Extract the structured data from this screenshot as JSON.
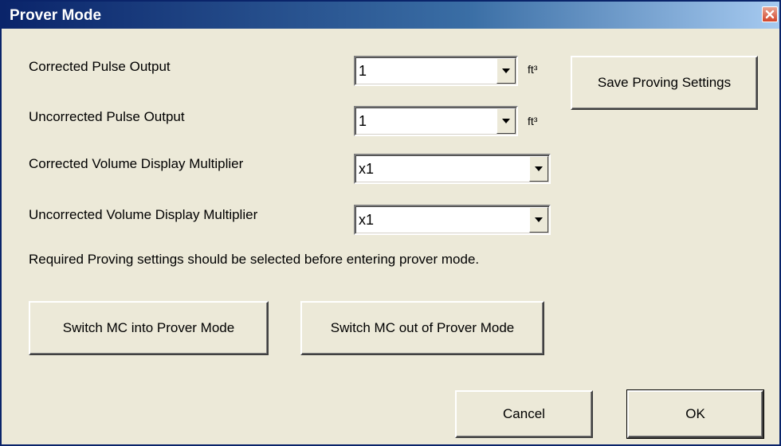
{
  "window": {
    "title": "Prover Mode",
    "close_icon": "close-icon"
  },
  "fields": [
    {
      "label": "Corrected Pulse Output",
      "value": "1",
      "unit": "ft³"
    },
    {
      "label": "Uncorrected Pulse Output",
      "value": "1",
      "unit": "ft³"
    },
    {
      "label": "Corrected Volume Display Multiplier",
      "value": "x1"
    },
    {
      "label": "Uncorrected Volume Display Multiplier",
      "value": "x1"
    }
  ],
  "note": "Required Proving settings should be selected before entering prover mode.",
  "buttons": {
    "save_proving": "Save Proving Settings",
    "switch_into": "Switch MC into Prover Mode",
    "switch_out": "Switch MC out of Prover Mode",
    "cancel": "Cancel",
    "ok": "OK"
  },
  "colors": {
    "titlebar_start": "#0a246a",
    "dialog_bg": "#ece9d8",
    "close_button": "#d2452a"
  }
}
